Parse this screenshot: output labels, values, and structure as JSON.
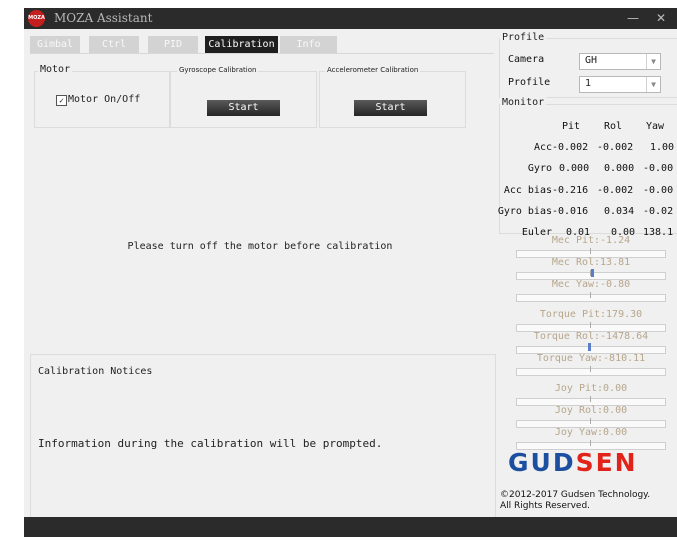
{
  "window": {
    "title": "MOZA Assistant",
    "logo_text": "MOZA"
  },
  "tabs": [
    {
      "label": "Gimbal"
    },
    {
      "label": "Ctrl"
    },
    {
      "label": "PID"
    },
    {
      "label": "Calibration",
      "active": true
    },
    {
      "label": "Info"
    }
  ],
  "motor": {
    "group_label": "Motor",
    "checkbox_label": "Motor On/Off",
    "checked": true
  },
  "gyro_calibration": {
    "group_label": "Gyroscope Calibration",
    "button_label": "Start"
  },
  "accel_calibration": {
    "group_label": "Accelerometer Calibration",
    "button_label": "Start"
  },
  "calibration_message": "Please turn off the motor before calibration",
  "notices": {
    "title": "Calibration Notices",
    "message": "Information during the calibration will be prompted."
  },
  "profile": {
    "group_label": "Profile",
    "camera_label": "Camera",
    "camera_value": "GH",
    "profile_label": "Profile",
    "profile_value": "1"
  },
  "monitor": {
    "group_label": "Monitor",
    "columns": [
      "Pit",
      "Rol",
      "Yaw"
    ],
    "rows": [
      {
        "label": "Acc",
        "values": [
          "-0.002",
          "-0.002",
          "1.00"
        ]
      },
      {
        "label": "Gyro",
        "values": [
          "0.000",
          "0.000",
          "-0.00"
        ]
      },
      {
        "label": "Acc bias",
        "values": [
          "-0.216",
          "-0.002",
          "-0.00"
        ]
      },
      {
        "label": "Gyro bias",
        "values": [
          "-0.016",
          "0.034",
          "-0.02"
        ]
      },
      {
        "label": "Euler",
        "values": [
          "0.01",
          "0.00",
          "138.1"
        ]
      }
    ]
  },
  "meters": [
    {
      "label": "Mec Pit:-1.24",
      "fill": 0.0
    },
    {
      "label": "Mec Rol:13.81",
      "fill": 0.02
    },
    {
      "label": "Mec Yaw:-0.80",
      "fill": 0.0
    },
    {
      "label": "Torque Pit:179.30",
      "fill": 0.0
    },
    {
      "label": "Torque Rol:-1478.64",
      "fill": -0.02
    },
    {
      "label": "Torque Yaw:-810.11",
      "fill": 0.0
    },
    {
      "label": "Joy Pit:0.00",
      "fill": 0.0
    },
    {
      "label": "Joy Rol:0.00",
      "fill": 0.0
    },
    {
      "label": "Joy Yaw:0.00",
      "fill": 0.0
    }
  ],
  "brand": {
    "name_part1": "GUD",
    "name_part2": "SEN",
    "color1": "#1d4fa0",
    "color2": "#e2231a"
  },
  "copyright": {
    "line1": "©2012-2017 Gudsen Technology.",
    "line2": "All Rights Reserved."
  },
  "colors": {
    "titlebar": "#2b2b2b",
    "tab_active": "#1f1f1f",
    "meter_fill": "#5b7fc7",
    "meter_text": "#b7a68b"
  }
}
